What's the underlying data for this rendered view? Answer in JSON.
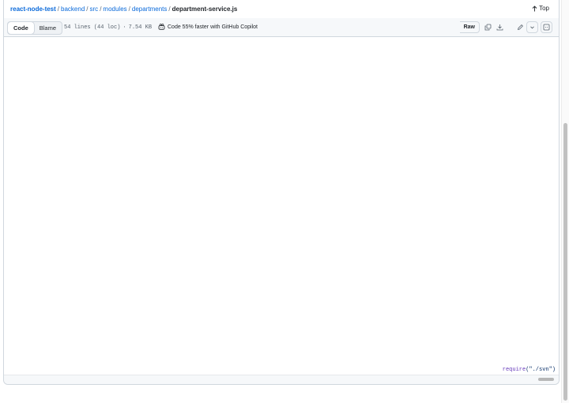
{
  "breadcrumb": {
    "repo": "react-node-test",
    "parts": [
      "backend",
      "src",
      "modules",
      "departments"
    ],
    "current": "department-service.js",
    "separator": "/"
  },
  "top_link": {
    "label": "Top"
  },
  "toolbar": {
    "tabs": [
      {
        "label": "Code",
        "active": true
      },
      {
        "label": "Blame",
        "active": false
      }
    ],
    "lines_info": "54 lines (44 loc)",
    "dot": "·",
    "size": "7.54 KB",
    "copilot_text": "Code 55% faster with GitHub Copilot",
    "raw_label": "Raw"
  },
  "code": {
    "snippet_fn": "require",
    "snippet_arg": "(\"./svn\")"
  },
  "colors": {
    "link": "#0969da",
    "border": "#d0d7de",
    "toolbar_bg": "#f6f8fa"
  },
  "icons": [
    "arrow-up-icon",
    "copilot-icon",
    "copy-icon",
    "download-icon",
    "pencil-icon",
    "chevron-down-icon",
    "symbols-panel-icon"
  ]
}
